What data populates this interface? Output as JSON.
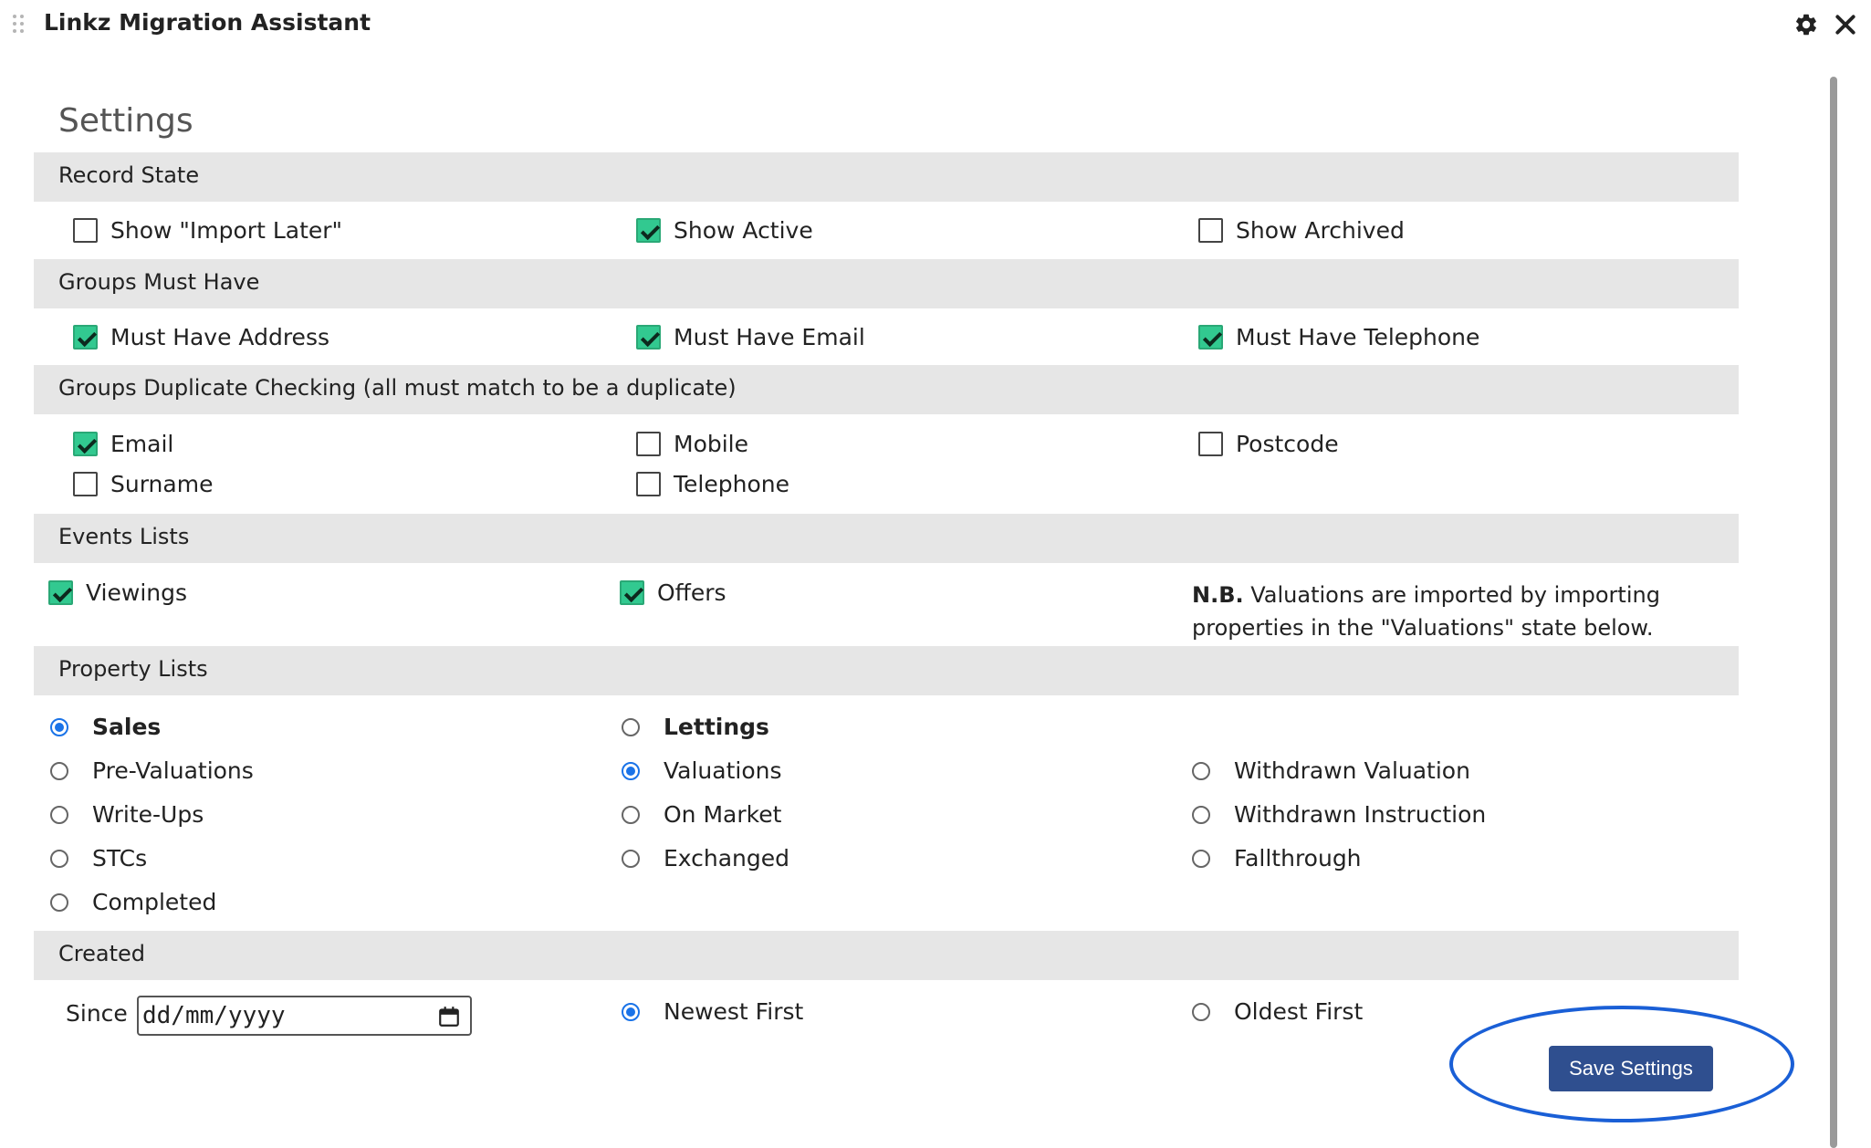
{
  "window": {
    "title": "Linkz Migration Assistant"
  },
  "page": {
    "title": "Settings"
  },
  "sections": {
    "record_state": {
      "heading": "Record State",
      "options": [
        {
          "label": "Show \"Import Later\"",
          "checked": false
        },
        {
          "label": "Show Active",
          "checked": true
        },
        {
          "label": "Show Archived",
          "checked": false
        }
      ]
    },
    "groups_must_have": {
      "heading": "Groups Must Have",
      "options": [
        {
          "label": "Must Have Address",
          "checked": true
        },
        {
          "label": "Must Have Email",
          "checked": true
        },
        {
          "label": "Must Have Telephone",
          "checked": true
        }
      ]
    },
    "dup_checking": {
      "heading": "Groups Duplicate Checking (all must match to be a duplicate)",
      "options": [
        {
          "label": "Email",
          "checked": true
        },
        {
          "label": "Mobile",
          "checked": false
        },
        {
          "label": "Postcode",
          "checked": false
        },
        {
          "label": "Surname",
          "checked": false
        },
        {
          "label": "Telephone",
          "checked": false
        }
      ]
    },
    "events_lists": {
      "heading": "Events Lists",
      "options": [
        {
          "label": "Viewings",
          "checked": true
        },
        {
          "label": "Offers",
          "checked": true
        }
      ],
      "note_bold": "N.B.",
      "note_text": " Valuations are imported by importing properties in the \"Valuations\" state below."
    },
    "property_lists": {
      "heading": "Property Lists",
      "options": [
        {
          "label": "Sales",
          "checked": true
        },
        {
          "label": "Lettings",
          "checked": false
        },
        {
          "label": "Pre-Valuations",
          "checked": false
        },
        {
          "label": "Valuations",
          "checked": true
        },
        {
          "label": "Withdrawn Valuation",
          "checked": false
        },
        {
          "label": "Write-Ups",
          "checked": false
        },
        {
          "label": "On Market",
          "checked": false
        },
        {
          "label": "Withdrawn Instruction",
          "checked": false
        },
        {
          "label": "STCs",
          "checked": false
        },
        {
          "label": "Exchanged",
          "checked": false
        },
        {
          "label": "Fallthrough",
          "checked": false
        },
        {
          "label": "Completed",
          "checked": false
        }
      ]
    },
    "created": {
      "heading": "Created",
      "since_label": "Since",
      "date_placeholder": "dd/mm/yyyy",
      "options": [
        {
          "label": "Newest First",
          "checked": true
        },
        {
          "label": "Oldest First",
          "checked": false
        }
      ]
    }
  },
  "actions": {
    "save_label": "Save Settings"
  },
  "colors": {
    "accent": "#1a73e8",
    "check_green": "#32c990",
    "button": "#2f4f8f",
    "band": "#e6e6e6"
  }
}
